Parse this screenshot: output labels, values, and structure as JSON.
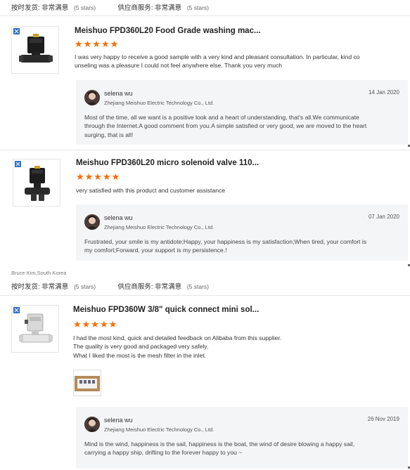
{
  "ratings_top": {
    "shipping_label": "按时发货:",
    "shipping_value": "非常满意",
    "shipping_stars": "(5 stars)",
    "service_label": "供应商服务:",
    "service_value": "非常满意",
    "service_stars": "(5 stars)"
  },
  "reviews": [
    {
      "product_title": "Meishuo FPD360L20 Food Grade washing mac...",
      "stars": "★★★★★",
      "text_lines": [
        "I was very happy to receive a good sample with a very kind and pleasant consultation. In particular, kind co",
        "unseling was a pleasure I could not feel anywhere else. Thank you very much"
      ],
      "reply": {
        "name": "selena wu",
        "company": "Zhejiang Meishuo Electric Technology Co., Ltd.",
        "date": "14 Jan 2020",
        "lines": [
          "Most of the time, all we want is a positive look and a heart of understanding, that's all.We communicate",
          "through the Internet.A good comment from you.A simple satisfied or very good, we are moved to the heart",
          "surging, that is all!"
        ]
      }
    },
    {
      "product_title": "Meishuo FPD360L20 micro solenoid valve 110...",
      "stars": "★★★★★",
      "text_lines": [
        "very satisfied  with this product and customer assistance"
      ],
      "reply": {
        "name": "selena wu",
        "company": "Zhejiang Meishuo Electric Technology Co., Ltd.",
        "date": "07 Jan 2020",
        "lines": [
          "Frustrated, your smile is my antidote;Happy, your happiness is my satisfaction;When tired, your comfort is",
          "my comfort;Forward, your support is my persistence.!"
        ]
      }
    },
    {
      "buyer": "Bruce Kim,South Korea",
      "ratings": {
        "shipping_label": "按时发货:",
        "shipping_value": "非常满意",
        "shipping_stars": "(5 stars)",
        "service_label": "供应商服务:",
        "service_value": "非常满意",
        "service_stars": "(5 stars)"
      },
      "product_title": "Meishuo FPD360W 3/8\" quick connect mini sol...",
      "stars": "★★★★★",
      "text_lines": [
        "I had the most kind, quick and detailed feedback on Alibaba from this supplier.",
        "The quality is very good and packaged very safely.",
        "What I liked the most is the mesh filter in the inlet."
      ],
      "reply": {
        "name": "selena wu",
        "company": "Zhejiang Meishuo Electric Technology Co., Ltd.",
        "date": "26 Nov 2019",
        "lines": [
          "Mind is the wind, happiness is the sail, happiness is the boat, the wind of desire blowing a happy sail,",
          "carrying a happy ship, drifting to the forever happy to you ~"
        ]
      }
    }
  ],
  "colors": {
    "star": "#ff6a00",
    "reply_bg": "#f4f5f7",
    "flag": "#2b6cc4"
  },
  "icons": {
    "flag": "flag-icon",
    "avatar": "avatar",
    "product": "solenoid-valve-image"
  }
}
